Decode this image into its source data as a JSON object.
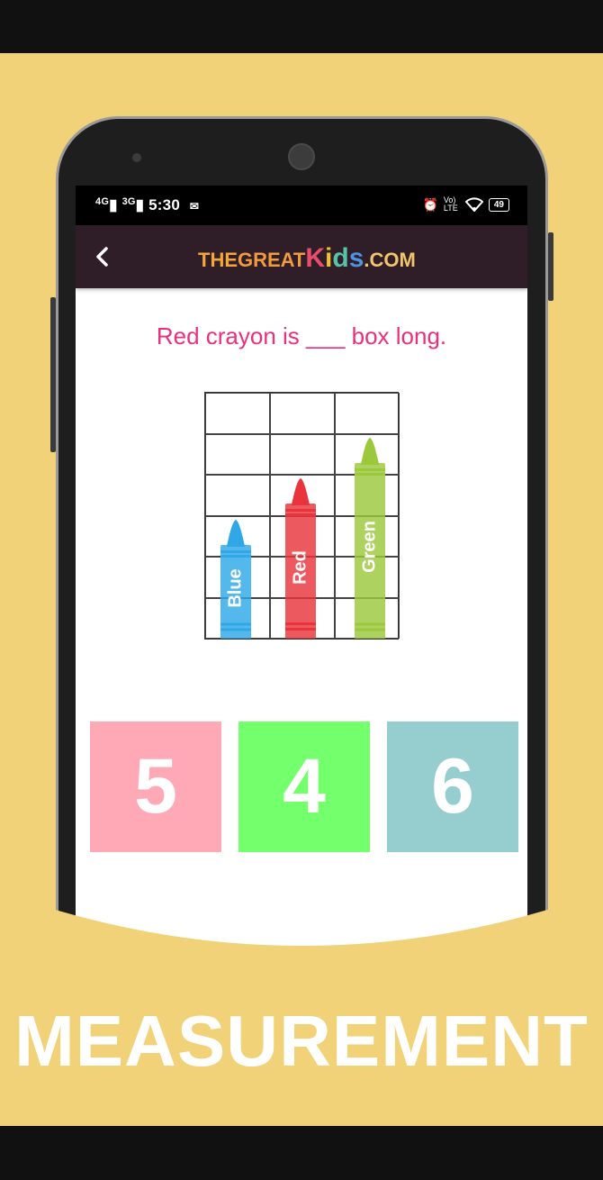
{
  "status_bar": {
    "net1": "4G",
    "net2": "3G",
    "time": "5:30",
    "mail_icon": "mail-icon",
    "alarm_icon": "alarm-icon",
    "volte": "Vo) LTE",
    "wifi_icon": "wifi-icon",
    "battery": "49"
  },
  "header": {
    "back_icon": "chevron-left-icon",
    "logo": {
      "the": "THE",
      "great": "GREAT",
      "k": "K",
      "i": "i",
      "d": "d",
      "s": "s",
      "com": ".COM"
    }
  },
  "question": "Red crayon is ___ box long.",
  "crayons": [
    {
      "label": "Blue",
      "color": "#30a8e8",
      "boxes": 3
    },
    {
      "label": "Red",
      "color": "#e8343a",
      "boxes": 4
    },
    {
      "label": "Green",
      "color": "#9cc83c",
      "boxes": 5
    }
  ],
  "options": [
    {
      "label": "5",
      "color": "#ffa8b6"
    },
    {
      "label": "4",
      "color": "#74ff6c"
    },
    {
      "label": "6",
      "color": "#96ced0"
    }
  ],
  "banner_title": "MEASUREMENT",
  "colors": {
    "background": "#f1d278",
    "header": "#2f1e28",
    "question": "#e8307e"
  }
}
